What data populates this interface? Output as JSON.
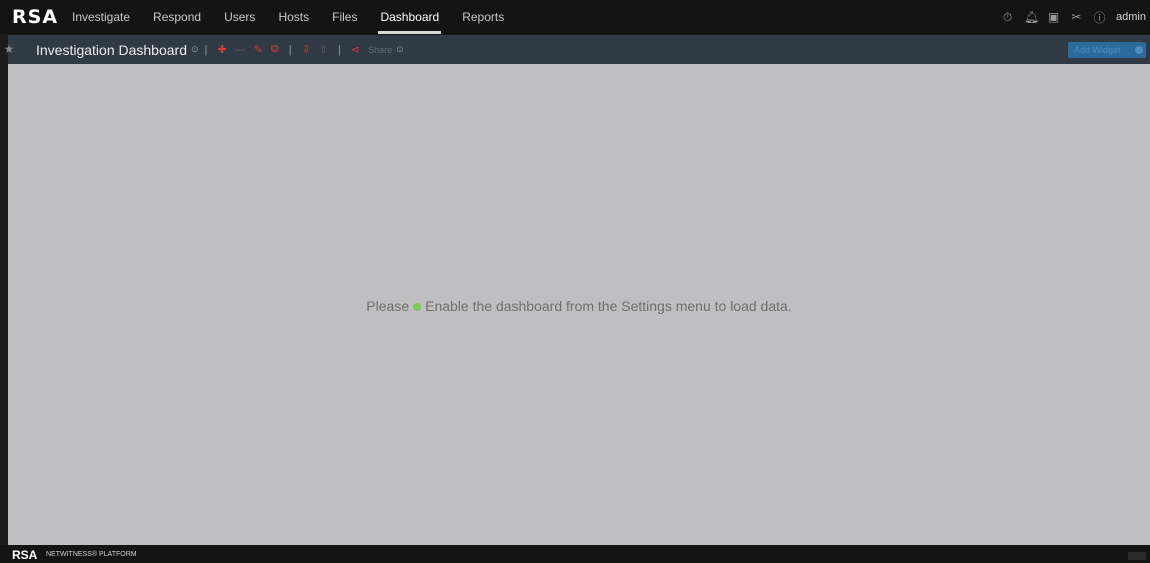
{
  "topbar": {
    "logo": "RSA",
    "nav": [
      "Investigate",
      "Respond",
      "Users",
      "Hosts",
      "Files",
      "Dashboard",
      "Reports"
    ],
    "active_nav": "Dashboard",
    "icons": [
      "timer-icon",
      "bell-icon",
      "tasks-icon",
      "tools-icon",
      "help-icon"
    ],
    "user": "admin"
  },
  "toolbar": {
    "title": "Investigation Dashboard",
    "share_label": "Share",
    "add_widget_label": "Add Widget",
    "colors": {
      "accent_red": "#d63a3a",
      "button_blue": "#2a6b9c"
    }
  },
  "content": {
    "message_prefix": "Please",
    "message_body": "Enable the dashboard from the Settings menu to load data.",
    "status_dot_color": "#7ec85a"
  },
  "footer": {
    "logo": "RSA",
    "product": "NETWITNESS® PLATFORM"
  }
}
